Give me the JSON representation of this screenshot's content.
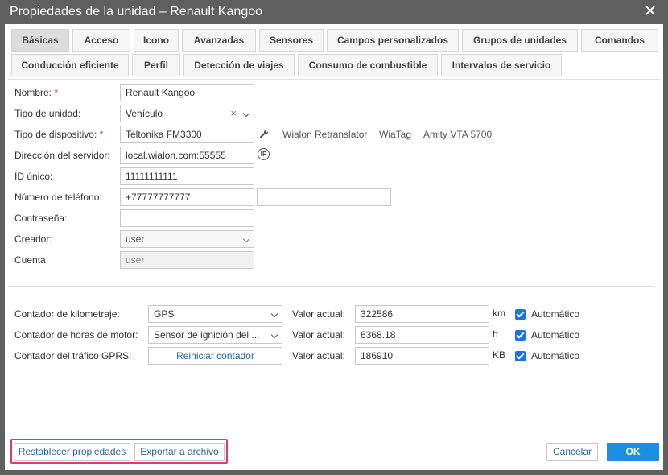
{
  "dialog": {
    "title": "Propiedades de la unidad – Renault Kangoo"
  },
  "tabs": [
    "Básicas",
    "Acceso",
    "Icono",
    "Avanzadas",
    "Sensores",
    "Campos personalizados",
    "Grupos de unidades",
    "Comandos",
    "Conducción eficiente",
    "Perfil",
    "Detección de viajes",
    "Consumo de combustible",
    "Intervalos de servicio"
  ],
  "active_tab": "Básicas",
  "form": {
    "name_label": "Nombre:",
    "name_value": "Renault Kangoo",
    "unit_type_label": "Tipo de unidad:",
    "unit_type_value": "Vehículo",
    "device_type_label": "Tipo de dispositivo:",
    "device_type_value": "Teltonika FM3300",
    "device_links": [
      "Wialon Retranslator",
      "WiaTag",
      "Amity VTA 5700"
    ],
    "server_label": "Dirección del servidor:",
    "server_value": "local.wialon.com:55555",
    "ip_label": "IP",
    "uid_label": "ID único:",
    "uid_value": "11111111111",
    "phone_label": "Número de teléfono:",
    "phone_value": "+77777777777",
    "phone2_value": "",
    "password_label": "Contraseña:",
    "password_value": "",
    "creator_label": "Creador:",
    "creator_value": "user",
    "account_label": "Cuenta:",
    "account_value": "user",
    "required_mark": "*"
  },
  "counters": {
    "current_label": "Valor actual:",
    "auto_label": "Automático",
    "reset_label": "Reiniciar contador",
    "rows": [
      {
        "label": "Contador de kilometraje:",
        "select": "GPS",
        "value": "322586",
        "unit": "km",
        "auto": true
      },
      {
        "label": "Contador de horas de motor:",
        "select": "Sensor de ignición del ...",
        "value": "6368.18",
        "unit": "h",
        "auto": true
      },
      {
        "label": "Contador del tráfico GPRS:",
        "select": "",
        "value": "186910",
        "unit": "KB",
        "auto": true
      }
    ]
  },
  "footer": {
    "reset_props": "Restablecer propiedades",
    "export": "Exportar a archivo",
    "cancel": "Cancelar",
    "ok": "OK"
  },
  "colors": {
    "accent": "#1a8fe3",
    "highlight": "#e8336e",
    "titlebar": "#5f5f5f",
    "required": "#e0203c"
  }
}
